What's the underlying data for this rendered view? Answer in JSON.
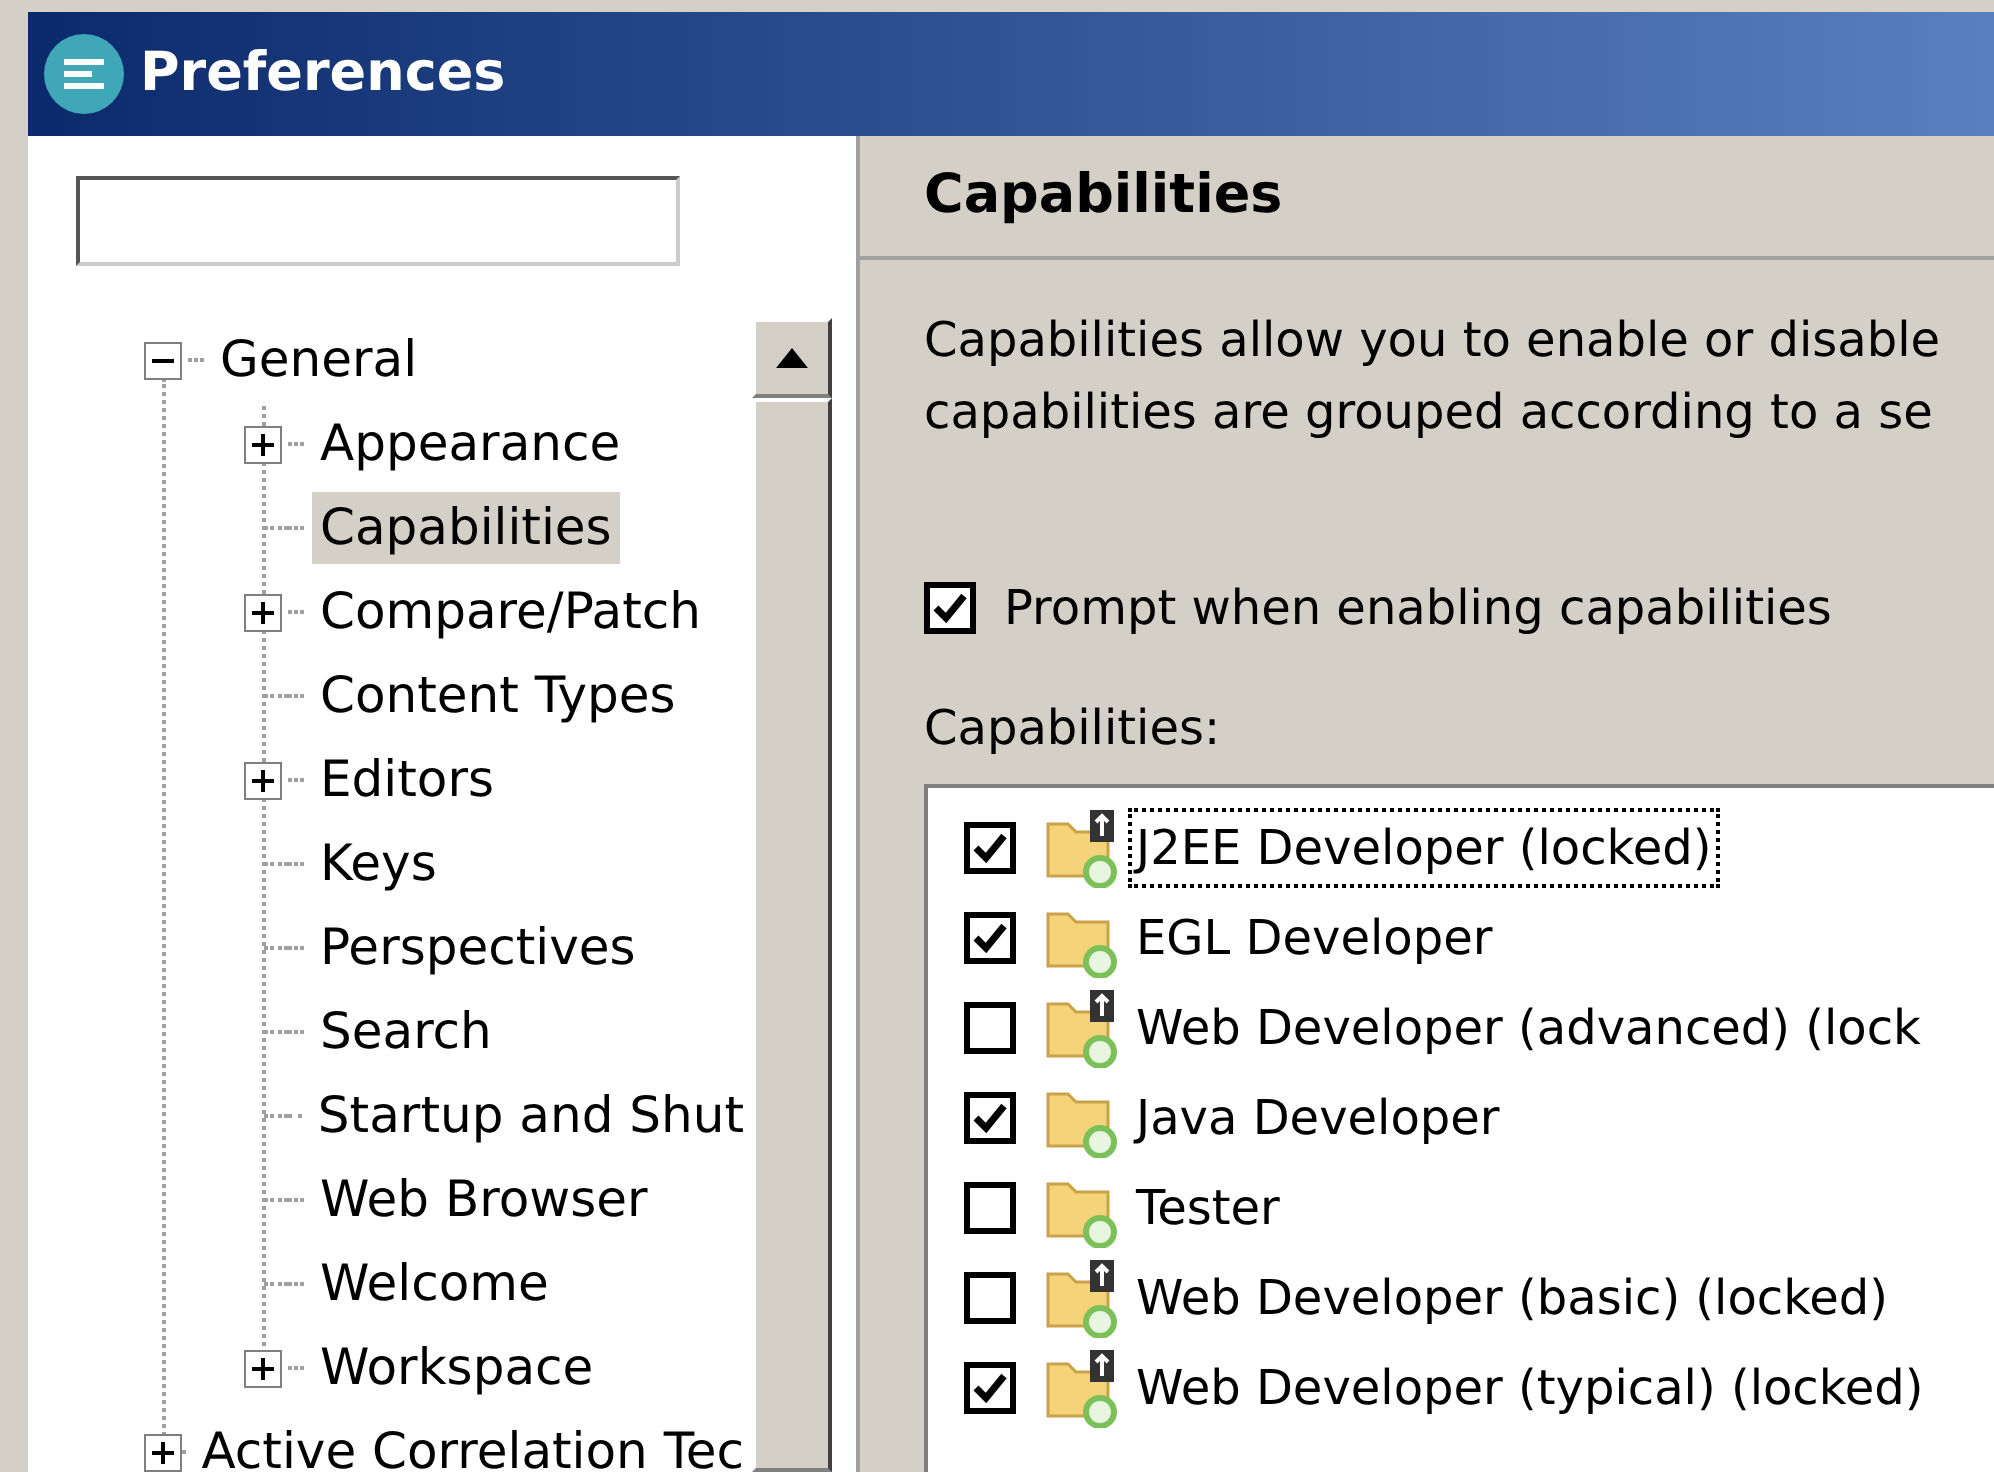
{
  "window": {
    "title": "Preferences"
  },
  "tree": [
    {
      "label": "General",
      "expanded": true,
      "selected": false,
      "children": [
        {
          "label": "Appearance",
          "expanded": false,
          "selected": false
        },
        {
          "label": "Capabilities",
          "selected": true
        },
        {
          "label": "Compare/Patch",
          "expanded": false,
          "selected": false
        },
        {
          "label": "Content Types",
          "selected": false
        },
        {
          "label": "Editors",
          "expanded": false,
          "selected": false
        },
        {
          "label": "Keys",
          "selected": false
        },
        {
          "label": "Perspectives",
          "selected": false
        },
        {
          "label": "Search",
          "selected": false
        },
        {
          "label": "Startup and Shut",
          "selected": false
        },
        {
          "label": "Web Browser",
          "selected": false
        },
        {
          "label": "Welcome",
          "selected": false
        },
        {
          "label": "Workspace",
          "expanded": false,
          "selected": false
        }
      ]
    },
    {
      "label": "Active Correlation Tec",
      "expanded": false,
      "selected": false
    }
  ],
  "page": {
    "title": "Capabilities",
    "description": [
      "Capabilities allow you to enable or disable",
      "capabilities are grouped according to a se"
    ],
    "prompt": {
      "label": "Prompt when enabling capabilities",
      "checked": true
    },
    "list_label": "Capabilities:",
    "capabilities": [
      {
        "label": "J2EE Developer (locked)",
        "checked": true,
        "locked": true,
        "focused": true
      },
      {
        "label": "EGL Developer",
        "checked": true,
        "locked": false,
        "focused": false
      },
      {
        "label": "Web Developer (advanced) (lock",
        "checked": false,
        "locked": true,
        "focused": false
      },
      {
        "label": "Java Developer",
        "checked": true,
        "locked": false,
        "focused": false
      },
      {
        "label": "Tester",
        "checked": false,
        "locked": false,
        "focused": false
      },
      {
        "label": "Web Developer (basic) (locked)",
        "checked": false,
        "locked": true,
        "focused": false
      },
      {
        "label": "Web Developer (typical) (locked)",
        "checked": true,
        "locked": true,
        "focused": false
      }
    ]
  }
}
